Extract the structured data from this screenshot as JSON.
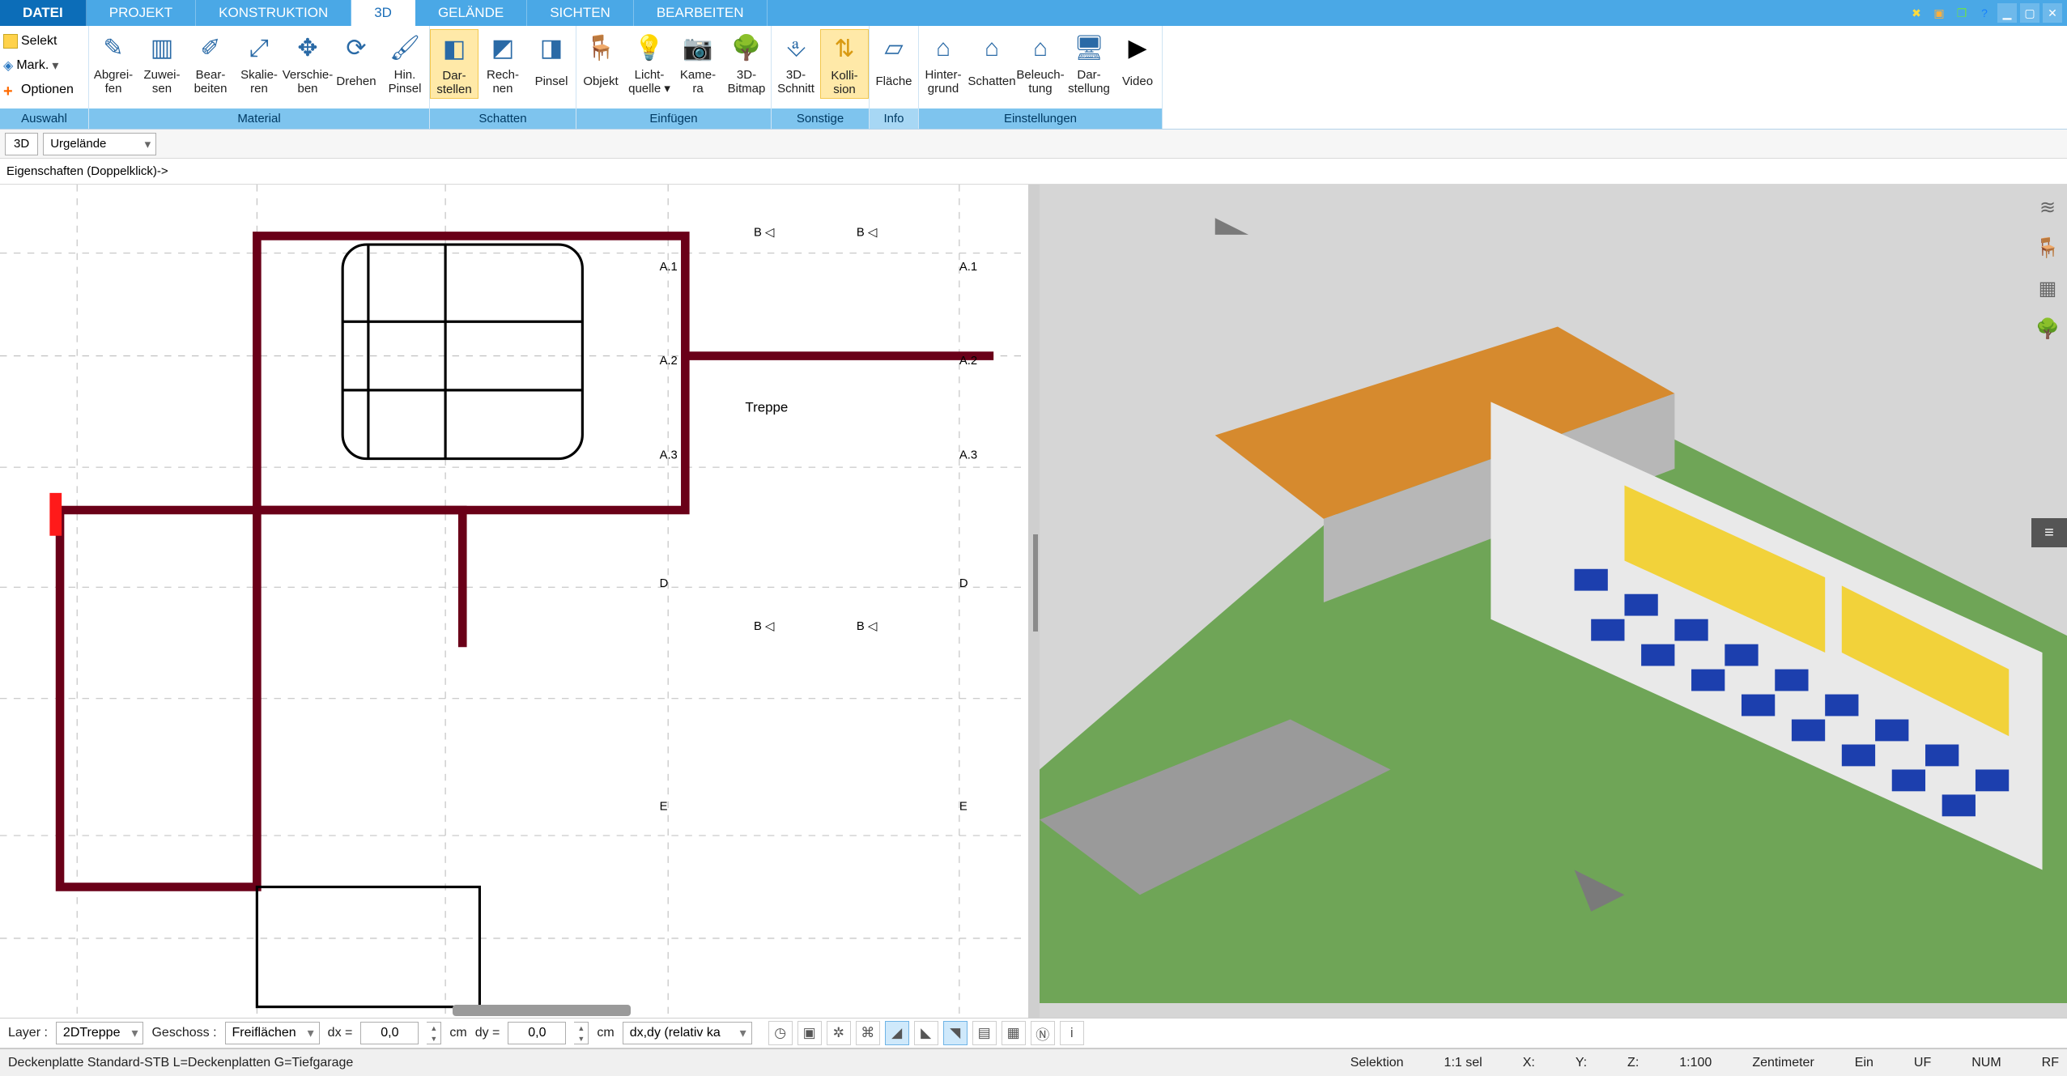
{
  "menu": [
    "DATEI",
    "PROJEKT",
    "KONSTRUKTION",
    "3D",
    "GELÄNDE",
    "SICHTEN",
    "BEARBEITEN"
  ],
  "menu_active": 3,
  "ribbon_left": {
    "select": "Selekt",
    "mark": "Mark.",
    "options": "Optionen"
  },
  "groups": {
    "auswahl": "Auswahl",
    "material": "Material",
    "schatten": "Schatten",
    "einfuegen": "Einfügen",
    "sonstige": "Sonstige",
    "info": "Info",
    "einstellungen": "Einstellungen"
  },
  "tools": {
    "abgreifen": {
      "l1": "Abgrei-",
      "l2": "fen",
      "icon": "✎"
    },
    "zuweisen": {
      "l1": "Zuwei-",
      "l2": "sen",
      "icon": "▥"
    },
    "bearbeiten": {
      "l1": "Bear-",
      "l2": "beiten",
      "icon": "✐"
    },
    "skalieren": {
      "l1": "Skalie-",
      "l2": "ren",
      "icon": "⤢"
    },
    "verschieben": {
      "l1": "Verschie-",
      "l2": "ben",
      "icon": "✥"
    },
    "drehen": {
      "l1": "Drehen",
      "l2": "",
      "icon": "⟳"
    },
    "hinpinsel": {
      "l1": "Hin.",
      "l2": "Pinsel",
      "icon": "🖌"
    },
    "darstellen": {
      "l1": "Dar-",
      "l2": "stellen",
      "icon": "◧"
    },
    "rechnen": {
      "l1": "Rech-",
      "l2": "nen",
      "icon": "◩"
    },
    "pinsel": {
      "l1": "Pinsel",
      "l2": "",
      "icon": "◨"
    },
    "objekt": {
      "l1": "Objekt",
      "l2": "",
      "icon": "🪑"
    },
    "licht": {
      "l1": "Licht-",
      "l2": "quelle ▾",
      "icon": "💡"
    },
    "kamera": {
      "l1": "Kame-",
      "l2": "ra",
      "icon": "📷"
    },
    "baum": {
      "l1": "3D-",
      "l2": "Bitmap",
      "icon": "🌳"
    },
    "schnitt": {
      "l1": "3D-",
      "l2": "Schnitt",
      "icon": "⎀"
    },
    "kollision": {
      "l1": "Kolli-",
      "l2": "sion",
      "icon": "⇅"
    },
    "flaeche": {
      "l1": "Fläche",
      "l2": "",
      "icon": "▱"
    },
    "hintergrund": {
      "l1": "Hinter-",
      "l2": "grund",
      "icon": "⌂"
    },
    "schattenE": {
      "l1": "Schatten",
      "l2": "",
      "icon": "⌂"
    },
    "beleuchtung": {
      "l1": "Beleuch-",
      "l2": "tung",
      "icon": "⌂"
    },
    "darstellung": {
      "l1": "Dar-",
      "l2": "stellung",
      "icon": "🖥"
    },
    "video": {
      "l1": "Video",
      "l2": "",
      "icon": "▶"
    }
  },
  "subbar": {
    "btn3d": "3D",
    "terrain": "Urgelände"
  },
  "propbar": "Eigenschaften (Doppelklick)->",
  "coord": {
    "layer_lbl": "Layer :",
    "layer_val": "2DTreppe",
    "geschoss_lbl": "Geschoss :",
    "geschoss_val": "Freiflächen",
    "dx_lbl": "dx =",
    "dx_val": "0,0",
    "dy_lbl": "dy =",
    "dy_val": "0,0",
    "unit": "cm",
    "mode": "dx,dy (relativ ka"
  },
  "plan_labels": {
    "treppe": "Treppe"
  },
  "status": {
    "left": "Deckenplatte Standard-STB L=Deckenplatten G=Tiefgarage",
    "sel": "Selektion",
    "ratio": "1:1 sel",
    "x": "X:",
    "y": "Y:",
    "z": "Z:",
    "scale": "1:100",
    "unit": "Zentimeter",
    "ein": "Ein",
    "uf": "UF",
    "num": "NUM",
    "rf": "RF"
  }
}
